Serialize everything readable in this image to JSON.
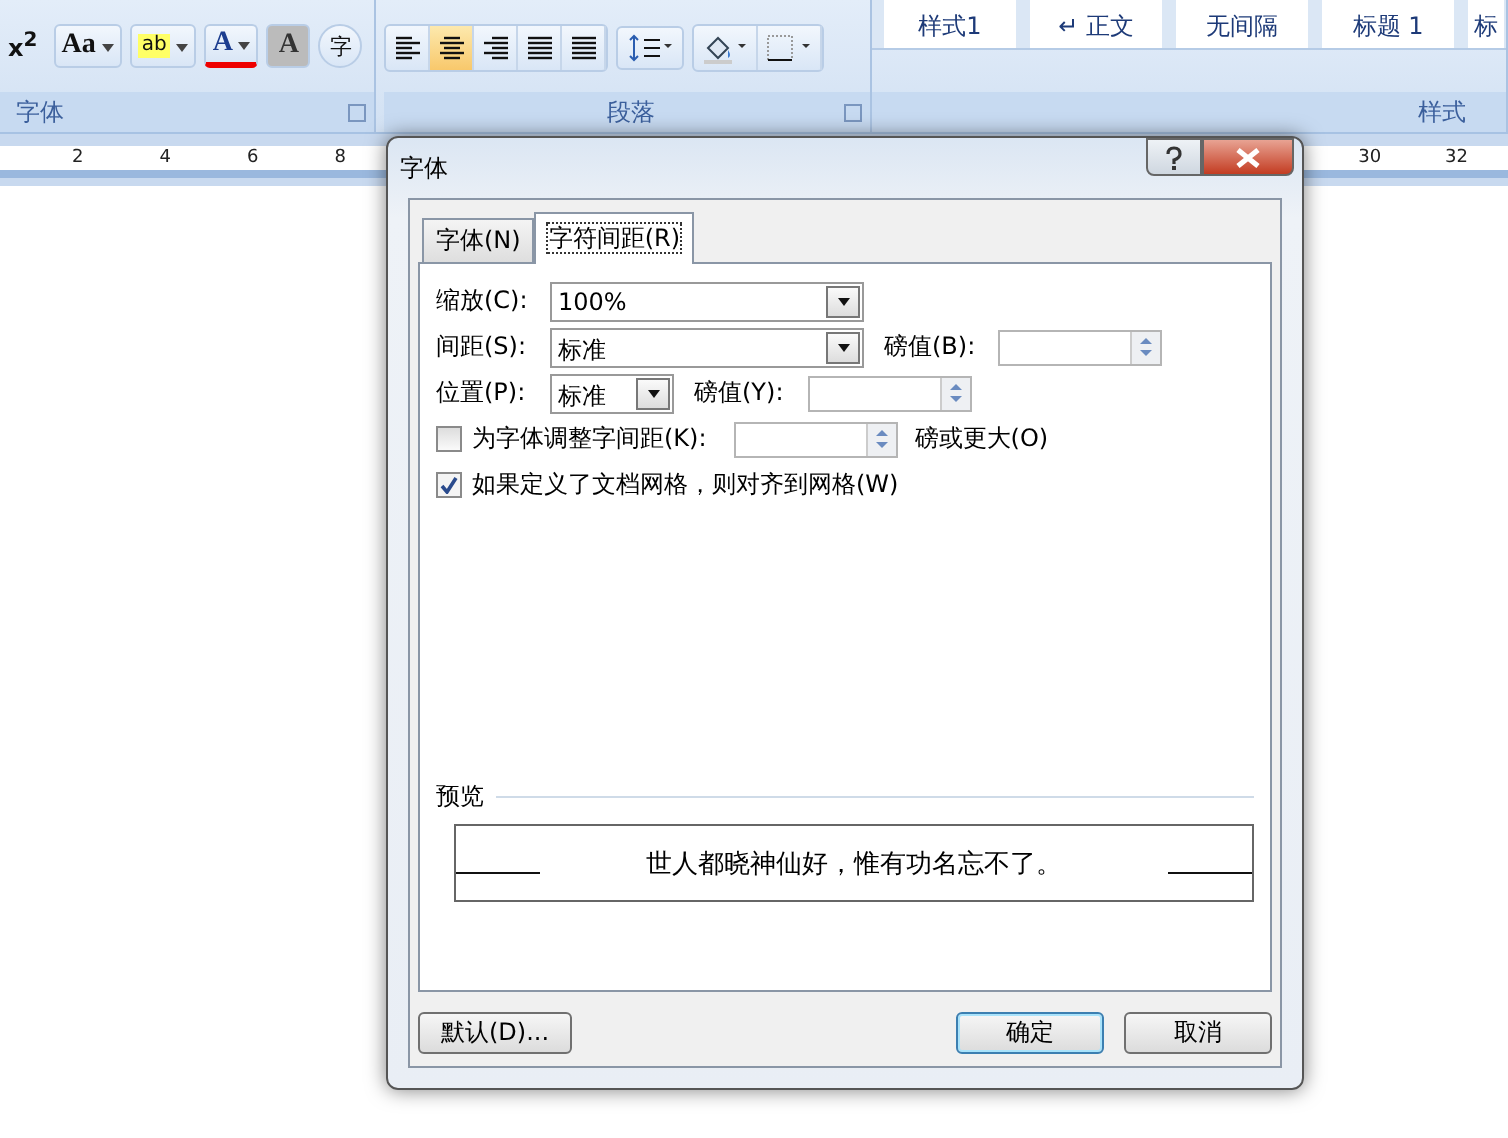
{
  "ribbon": {
    "font_group": {
      "label": "字体",
      "buttons": [
        {
          "kind": "superscript",
          "label": "x$^{2}$"
        },
        {
          "kind": "case",
          "label": "Aa"
        },
        {
          "kind": "highlight",
          "label": "ab"
        },
        {
          "kind": "font_color",
          "label": "A"
        },
        {
          "kind": "shading",
          "label": "A"
        },
        {
          "kind": "enclose",
          "label": "字"
        }
      ]
    },
    "paragraph_group": {
      "label": "段落",
      "align_buttons": [
        {
          "kind": "left",
          "selected": false
        },
        {
          "kind": "center",
          "selected": true
        },
        {
          "kind": "right",
          "selected": false
        },
        {
          "kind": "justify",
          "selected": false
        },
        {
          "kind": "distributed",
          "selected": false
        }
      ]
    },
    "styles_group": {
      "label": "样式",
      "styles": [
        "样式1",
        "↵ 正文",
        "无间隔",
        "标题 1",
        "标"
      ]
    }
  },
  "ruler": {
    "left_numbers": [
      "2",
      "4",
      "6",
      "8"
    ],
    "right_numbers": [
      "30",
      "32"
    ]
  },
  "dialog": {
    "title": "字体",
    "tabs": [
      {
        "label": "字体(N)",
        "selected": false
      },
      {
        "label": "字符间距(R)",
        "selected": true
      }
    ],
    "fields": [
      {
        "kind": "combo",
        "label": "缩放(C):",
        "value": "100%"
      },
      {
        "kind": "combo",
        "label": "间距(S):",
        "value": "标准",
        "extra": {
          "label": "磅值(B):"
        }
      },
      {
        "kind": "small_combo",
        "label": "位置(P):",
        "value": "标准",
        "extra": {
          "label": "磅值(Y):"
        }
      },
      {
        "kind": "check_spin",
        "label": "为字体调整字间距(K):",
        "checked": false,
        "suffix": "磅或更大(O)"
      },
      {
        "kind": "check",
        "label": "如果定义了文档网格，则对齐到网格(W)",
        "checked": true
      }
    ],
    "preview": {
      "label": "预览",
      "text": "世人都晓神仙好，惟有功名忘不了。"
    },
    "buttons": [
      {
        "label": "默认(D)...",
        "default": false
      },
      {
        "label": "确定",
        "default": true
      },
      {
        "label": "取消",
        "default": false
      }
    ]
  }
}
